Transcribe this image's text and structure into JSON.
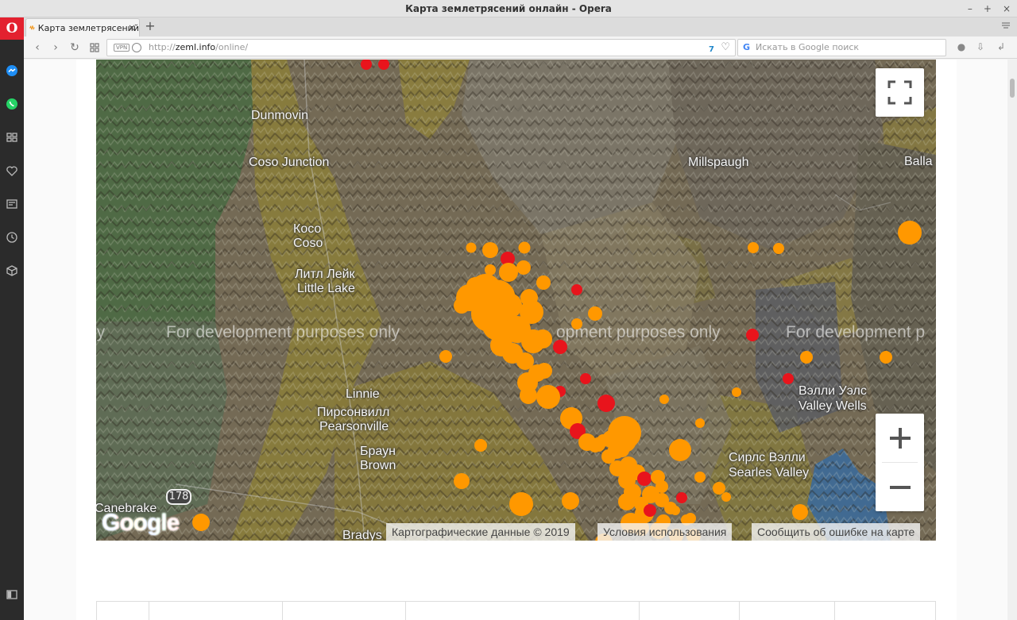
{
  "window": {
    "title": "Карта землетрясений онлайн - Opera",
    "controls": [
      "–",
      "+",
      "×"
    ]
  },
  "tab": {
    "label": "Карта землетрясений",
    "close": "×",
    "new_tab": "+"
  },
  "address": {
    "url_prefix": "http://",
    "url_host": "zeml.info",
    "url_path": "/online/",
    "vpn": "VPN",
    "ext_badge": "7",
    "search_placeholder": "Искать в Google поиск"
  },
  "map": {
    "dev_watermark": "For development purposes only",
    "dev_watermark_partial_left": "ly",
    "dev_watermark_partial_mid": "opment purposes only",
    "dev_watermark_partial_right": "For development p",
    "places": {
      "dunmovin": "Dunmovin",
      "coso_junction": "Coso Junction",
      "millspaugh": "Millspaugh",
      "balla": "Balla",
      "koso_ru": "Косо",
      "koso_en": "Coso",
      "little_lake_ru": "Литл Лейк",
      "little_lake_en": "Little Lake",
      "linnie": "Linnie",
      "pearsonville_ru": "Пирсонвилл",
      "pearsonville_en": "Pearsonville",
      "valley_wells_ru": "Вэлли Уэлс",
      "valley_wells_en": "Valley Wells",
      "brown_ru": "Браун",
      "brown_en": "Brown",
      "searles_valley_ru": "Сирлс Вэлли",
      "searles_valley_en": "Searles Valley",
      "canebrake": "Canebrake",
      "bradys": "Bradys"
    },
    "route_shield": "178",
    "google_logo": "Google",
    "attribution": {
      "map_data": "Картографические данные © 2019",
      "terms": "Условия использования",
      "report": "Сообщить об ошибке на карте"
    },
    "zoom_in": "+",
    "zoom_out": "−",
    "colors": {
      "quake_orange": "#ff9800",
      "quake_red": "#e8141c"
    }
  }
}
